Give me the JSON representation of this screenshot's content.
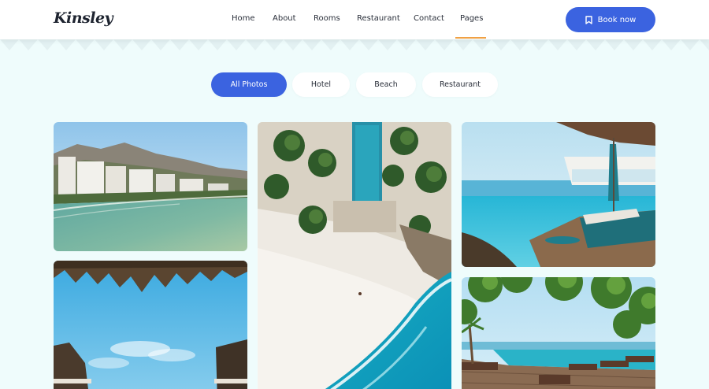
{
  "brand": {
    "name": "Kinsley"
  },
  "nav": {
    "items": [
      "Home",
      "About",
      "Rooms",
      "Restaurant",
      "Contact",
      "Pages"
    ],
    "active": "Pages"
  },
  "header": {
    "book_label": "Book now"
  },
  "filters": {
    "items": [
      "All Photos",
      "Hotel",
      "Beach",
      "Restaurant"
    ],
    "active": "All Photos"
  },
  "gallery": {
    "photos": [
      "coastal-hotels-photo",
      "palm-canopy-sky-photo",
      "aerial-beach-pools-photo",
      "infinity-pool-lounger-photo",
      "tropical-pool-deck-photo"
    ]
  },
  "colors": {
    "accent": "#3b63e0",
    "nav_underline": "#f0a144",
    "background": "#effcfc"
  },
  "icons": {
    "book_icon": "bookmark-icon"
  }
}
